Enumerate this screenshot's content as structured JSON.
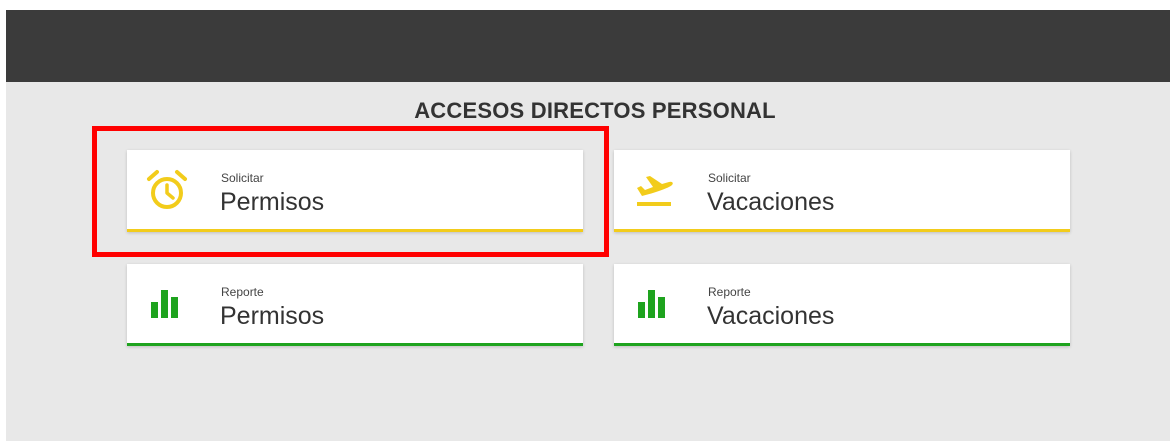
{
  "header": {
    "title": "ACCESOS DIRECTOS PERSONAL"
  },
  "cards": [
    {
      "subtitle": "Solicitar",
      "title": "Permisos",
      "icon": "alarm-clock-icon",
      "accent": "#f2cc1b"
    },
    {
      "subtitle": "Solicitar",
      "title": "Vacaciones",
      "icon": "airplane-takeoff-icon",
      "accent": "#f2cc1b"
    },
    {
      "subtitle": "Reporte",
      "title": "Permisos",
      "icon": "bar-chart-icon",
      "accent": "#1ea31e"
    },
    {
      "subtitle": "Reporte",
      "title": "Vacaciones",
      "icon": "bar-chart-icon",
      "accent": "#1ea31e"
    }
  ],
  "colors": {
    "topbar": "#3b3b3b",
    "background": "#e8e8e8",
    "highlight": "#ff0000"
  }
}
